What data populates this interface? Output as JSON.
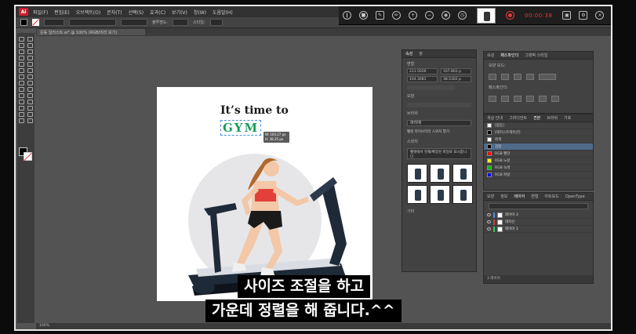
{
  "menubar": {
    "logo": "Ai",
    "items": [
      "파일(F)",
      "편집(E)",
      "오브젝트(O)",
      "문자(T)",
      "선택(S)",
      "효과(C)",
      "보기(V)",
      "창(W)",
      "도움말(H)"
    ]
  },
  "recorder": {
    "time": "00:00:38"
  },
  "control_bar": {
    "opacity_label": "불투명도:",
    "style_label": "스타일:"
  },
  "document_tab": {
    "title": "운동 일러스트.ai* @ 100% (RGB/미리 보기)"
  },
  "artboard": {
    "title": "It’s time to",
    "gym": "GYM",
    "tooltip_w": "W: 103.27 px",
    "tooltip_h": "H: 38.25 px"
  },
  "properties_panel": {
    "tabs": [
      "속성",
      "정"
    ],
    "transform_label": "변형",
    "x_value": "211.5026",
    "y_value": "104.3081",
    "w_value": "107.803 p",
    "h_value": "38.5302 p",
    "appearance_label": "모양",
    "brush_label": "브러쉬",
    "brush_value": "파라메",
    "toggle_label": "펠렛 라이브러리 스와치 열기",
    "desc_label": "스와치",
    "desc_text": "펠렛에서 현재/확장된 파일로 표시합니다",
    "footer_label": "기타"
  },
  "swatches_panel": {
    "tabs": [
      "속성",
      "패스파인더",
      "그래픽 스타일"
    ],
    "section1": "모양 모드:",
    "section2": "패스파인더:"
  },
  "color_panel": {
    "tabs": [
      "색상 안내",
      "그라디언트",
      "견본",
      "브러쉬",
      "기호"
    ],
    "rows": [
      "[없음]",
      "[레지스트레이션]",
      "흰색",
      "검정",
      "RGB 빨강",
      "RGB 노랑",
      "RGB 녹색",
      "RGB 파랑"
    ],
    "row_colors": [
      "#ffffff",
      "#000000",
      "#ffffff",
      "#000000",
      "#ff0000",
      "#ffff00",
      "#00c000",
      "#0000ff"
    ]
  },
  "layers_panel": {
    "tabs": [
      "모양",
      "정보",
      "레이어",
      "변형",
      "아트보드",
      "OpenType"
    ],
    "layers": [
      "레이어 3",
      "대지선",
      "레이어 1"
    ],
    "layer_colors": [
      "#4a90e2",
      "#d04040",
      "#2ec45e"
    ],
    "footer": "3 레이어"
  },
  "status_bar": {
    "zoom": "100%"
  },
  "subtitles": {
    "line1": "사이즈 조절을 하고",
    "line2": "가운데 정렬을 해 줍니다.^^"
  }
}
